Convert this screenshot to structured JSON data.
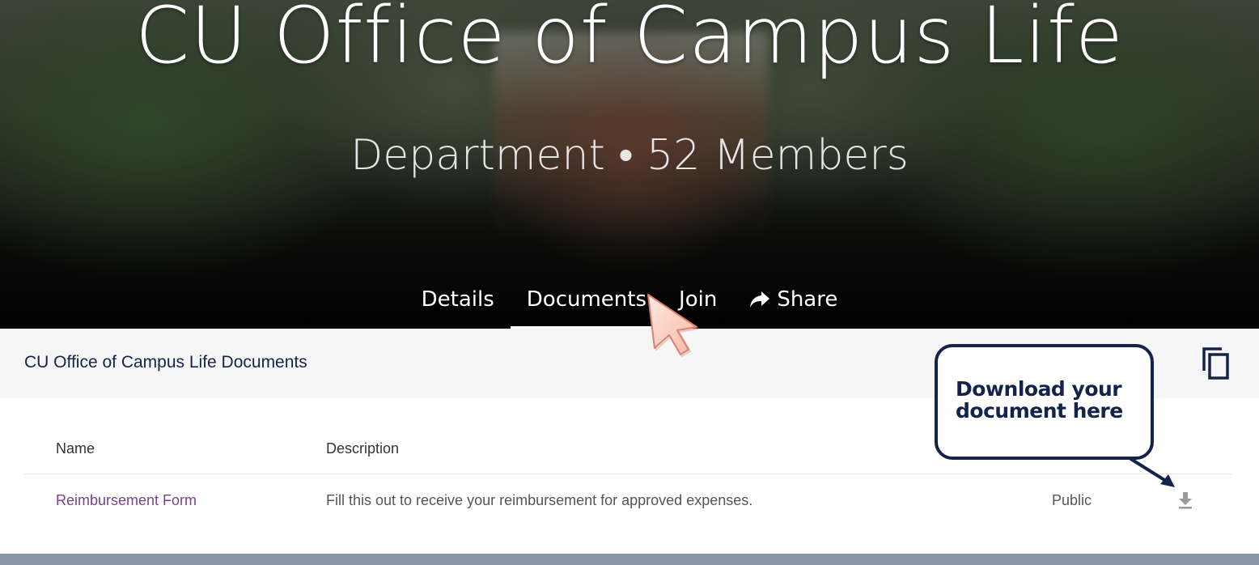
{
  "hero": {
    "title": "CU Office of Campus Life",
    "subtitle": "Department • 52 Members"
  },
  "tabs": [
    {
      "label": "Details",
      "active": false
    },
    {
      "label": "Documents",
      "active": true
    },
    {
      "label": "Join",
      "active": false
    },
    {
      "label": "Share",
      "active": false,
      "icon": "share-arrow-icon"
    }
  ],
  "documents": {
    "header_title": "CU Office of Campus Life Documents",
    "copy_icon": "copy-icon",
    "columns": {
      "name": "Name",
      "description": "Description"
    },
    "rows": [
      {
        "name": "Reimbursement Form",
        "description": "Fill this out to receive your reimbursement for approved expenses.",
        "visibility": "Public",
        "action_icon": "download-icon"
      }
    ]
  },
  "annotation": {
    "callout_text": "Download your document here",
    "cursor_icon": "mouse-cursor-icon"
  },
  "colors": {
    "accent_navy": "#14234a",
    "link_purple": "#7b3f8c",
    "footer_bar": "#8c96aa"
  }
}
